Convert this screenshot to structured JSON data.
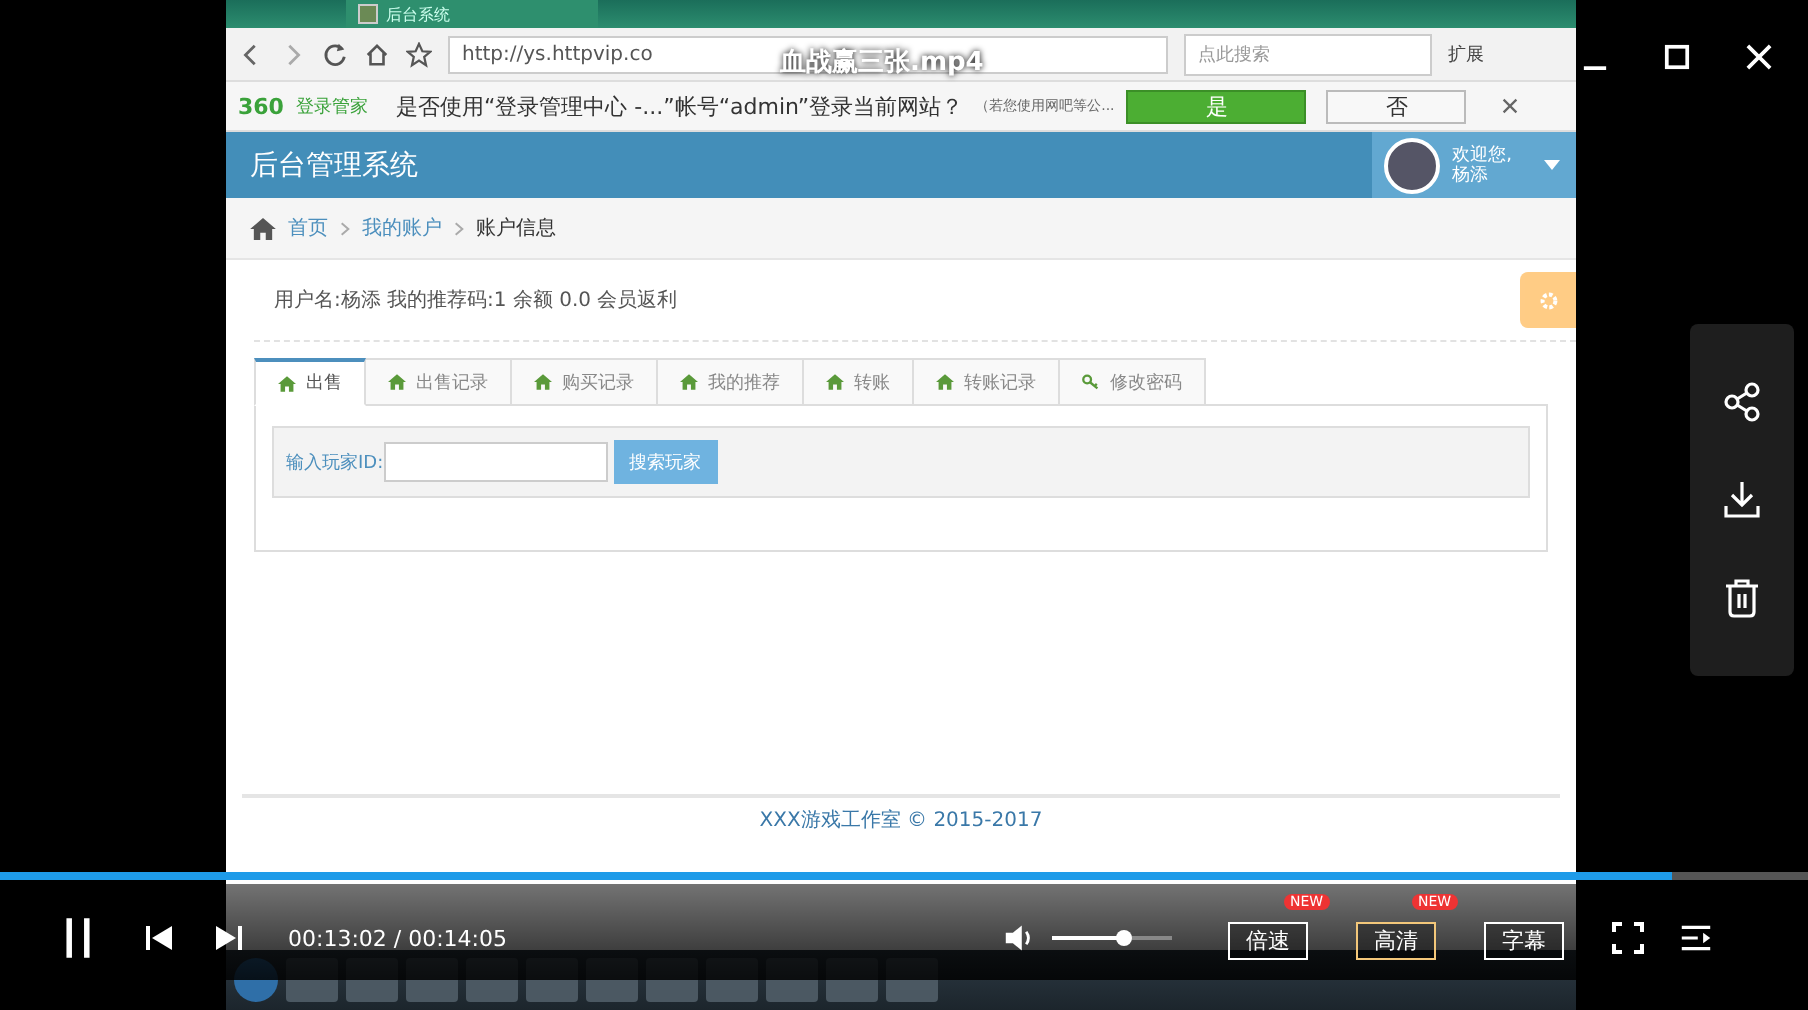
{
  "player": {
    "title": "血战赢三张.mp4",
    "playing": true,
    "progress": {
      "level": 0.925
    },
    "time": "00:13:02 / 00:14:05",
    "volume": {
      "level": 0.6
    },
    "buttons": [
      {
        "label": "倍速",
        "badge": "NEW",
        "highlighted": false
      },
      {
        "label": "高清",
        "badge": "NEW",
        "highlighted": true
      },
      {
        "label": "字幕",
        "highlighted": false
      }
    ]
  },
  "browser": {
    "tab_title": "后台系统",
    "url": "http://ys.httpvip.co",
    "search_placeholder": "点此搜索",
    "extensions": "扩展"
  },
  "login_prompt": {
    "logo": "360",
    "brand": "登录管家",
    "message": "是否使用“登录管理中心 -...”帐号“admin”登录当前网站？",
    "note": "（若您使用网吧等公...",
    "yes": "是",
    "no": "否"
  },
  "app": {
    "title": "后台管理系统",
    "greeting": "欢迎您,",
    "user": "杨添",
    "breadcrumb": [
      {
        "label": "首页",
        "link": true
      },
      {
        "label": "我的账户",
        "link": true
      },
      {
        "label": "账户信息",
        "link": false
      }
    ],
    "info": "用户名:杨添 我的推荐码:1 余额 0.0 会员返利",
    "tabs": [
      {
        "label": "出售",
        "kind": "home",
        "selected": true
      },
      {
        "label": "出售记录",
        "kind": "home",
        "selected": false
      },
      {
        "label": "购买记录",
        "kind": "home",
        "selected": false
      },
      {
        "label": "我的推荐",
        "kind": "home",
        "selected": false
      },
      {
        "label": "转账",
        "kind": "home",
        "selected": false
      },
      {
        "label": "转账记录",
        "kind": "home",
        "selected": false
      },
      {
        "label": "修改密码",
        "kind": "key",
        "selected": false
      }
    ],
    "search": {
      "label": "输入玩家ID:",
      "button": "搜索玩家"
    },
    "footer": "XXX游戏工作室 © 2015-2017"
  }
}
